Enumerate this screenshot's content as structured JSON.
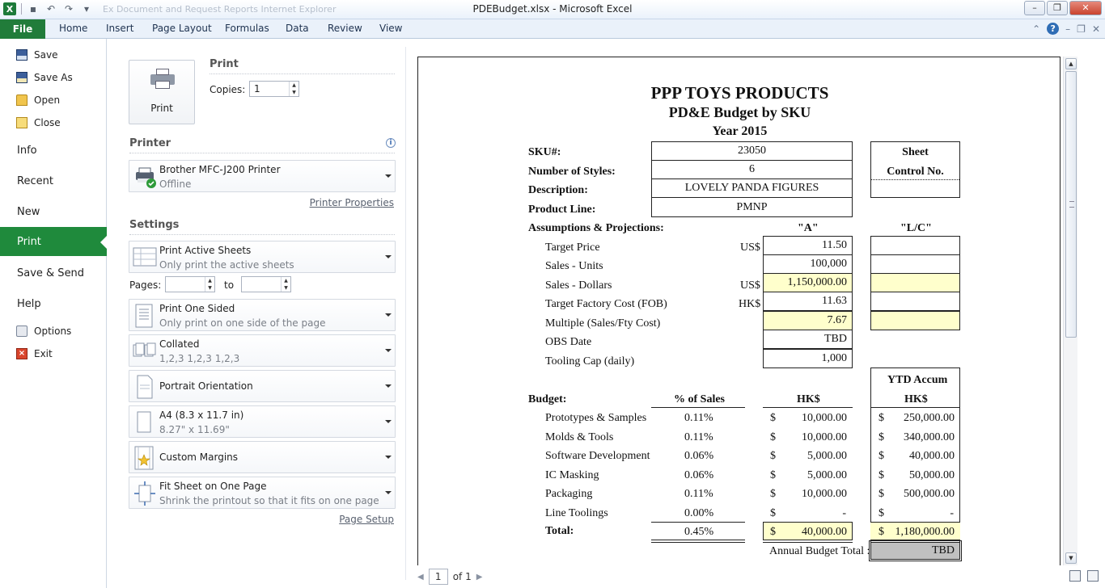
{
  "window": {
    "title": "PDEBudget.xlsx - Microsoft Excel",
    "qat_ghost_text": "Ex Document and Request Reports Internet Explorer",
    "controls": [
      "–",
      "❐",
      "✕"
    ]
  },
  "ribbon": {
    "file_tab": "File",
    "tabs": [
      "Home",
      "Insert",
      "Page Layout",
      "Formulas",
      "Data",
      "Review",
      "View"
    ]
  },
  "nav": {
    "save": "Save",
    "save_as": "Save As",
    "open": "Open",
    "close": "Close",
    "info": "Info",
    "recent": "Recent",
    "new": "New",
    "print": "Print",
    "save_send": "Save & Send",
    "help": "Help",
    "options": "Options",
    "exit": "Exit"
  },
  "print": {
    "section_title": "Print",
    "button_label": "Print",
    "copies_label": "Copies:",
    "copies_value": "1",
    "printer_title": "Printer",
    "printer_name": "Brother MFC-J200 Printer",
    "printer_status": "Offline",
    "printer_properties": "Printer Properties",
    "settings_title": "Settings",
    "sheets_main": "Print Active Sheets",
    "sheets_sub": "Only print the active sheets",
    "pages_label": "Pages:",
    "pages_to": "to",
    "sided_main": "Print One Sided",
    "sided_sub": "Only print on one side of the page",
    "collated_main": "Collated",
    "collated_sub": "1,2,3    1,2,3    1,2,3",
    "orientation": "Portrait Orientation",
    "paper_main": "A4 (8.3 x 11.7 in)",
    "paper_sub": "8.27\" x 11.69\"",
    "margins": "Custom Margins",
    "scaling_main": "Fit Sheet on One Page",
    "scaling_sub": "Shrink the printout so that it fits on one page",
    "page_setup": "Page Setup"
  },
  "preview": {
    "page_current": "1",
    "page_of": "of 1"
  },
  "sheet": {
    "title1": "PPP TOYS PRODUCTS",
    "title2": "PD&E Budget by SKU",
    "title3": "Year 2015",
    "sku_label": "SKU#:",
    "sku_value": "23050",
    "styles_label": "Number of Styles:",
    "styles_value": "6",
    "desc_label": "Description:",
    "desc_value": "LOVELY PANDA FIGURES",
    "line_label": "Product Line:",
    "line_value": "PMNP",
    "sheet_ctrl_1": "Sheet",
    "sheet_ctrl_2": "Control No.",
    "assumptions_label": "Assumptions & Projections:",
    "col_a": "\"A\"",
    "col_lc": "\"L/C\"",
    "assumptions": [
      {
        "label": "Target Price",
        "cur": "US$",
        "value": "11.50",
        "yellow": false
      },
      {
        "label": "Sales - Units",
        "cur": "",
        "value": "100,000",
        "yellow": false
      },
      {
        "label": "Sales - Dollars",
        "cur": "US$",
        "value": "1,150,000.00",
        "yellow": true
      },
      {
        "label": "Target Factory Cost (FOB)",
        "cur": "HK$",
        "value": "11.63",
        "yellow": false
      },
      {
        "label": "Multiple (Sales/Fty Cost)",
        "cur": "",
        "value": "7.67",
        "yellow": true
      },
      {
        "label": "OBS Date",
        "cur": "",
        "value": "TBD",
        "yellow": false
      },
      {
        "label": "Tooling Cap (daily)",
        "cur": "",
        "value": "1,000",
        "yellow": false
      }
    ],
    "ytd_header1": "YTD Accum",
    "ytd_header2": "HK$",
    "budget_label": "Budget:",
    "pct_header": "% of Sales",
    "hk_header": "HK$",
    "budget_rows": [
      {
        "label": "Prototypes & Samples",
        "pct": "0.11%",
        "hk": "10,000.00",
        "ytd": "250,000.00"
      },
      {
        "label": "Molds & Tools",
        "pct": "0.11%",
        "hk": "10,000.00",
        "ytd": "340,000.00"
      },
      {
        "label": "Software Development",
        "pct": "0.06%",
        "hk": "5,000.00",
        "ytd": "40,000.00"
      },
      {
        "label": "IC Masking",
        "pct": "0.06%",
        "hk": "5,000.00",
        "ytd": "50,000.00"
      },
      {
        "label": "Packaging",
        "pct": "0.11%",
        "hk": "10,000.00",
        "ytd": "500,000.00"
      },
      {
        "label": "Line Toolings",
        "pct": "0.00%",
        "hk": "-",
        "ytd": "-"
      }
    ],
    "dollar": "$",
    "total_label": "Total:",
    "total_pct": "0.45%",
    "total_hk": "40,000.00",
    "total_ytd": "1,180,000.00",
    "annual_label": "Annual Budget Total :",
    "annual_value": "TBD"
  }
}
